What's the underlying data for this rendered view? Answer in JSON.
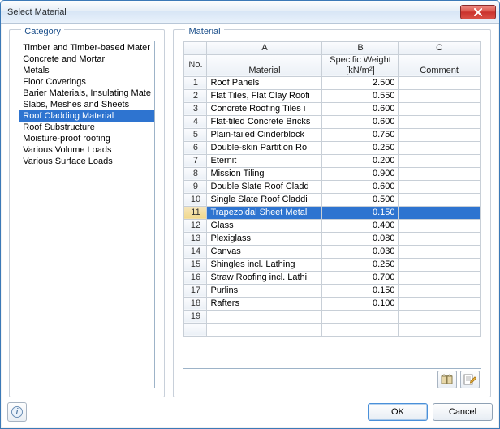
{
  "window": {
    "title": "Select Material"
  },
  "groups": {
    "category": "Category",
    "material": "Material"
  },
  "categories": {
    "items": [
      "Timber and Timber-based Mater",
      "Concrete and Mortar",
      "Metals",
      "Floor Coverings",
      "Barier Materials, Insulating Mate",
      "Slabs, Meshes and Sheets",
      "Roof Cladding Material",
      "Roof Substructure",
      "Moisture-proof roofing",
      "Various Volume Loads",
      "Various Surface Loads"
    ],
    "selected_index": 6
  },
  "grid": {
    "col_letters": [
      "A",
      "B",
      "C"
    ],
    "rowhead_label": "No.",
    "col_headers": {
      "A": "Material",
      "B_line1": "Specific Weight",
      "B_line2": "[kN/m²]",
      "C": "Comment"
    },
    "rows": [
      {
        "material": "Roof Panels",
        "weight": "2.500",
        "comment": ""
      },
      {
        "material": "Flat Tiles, Flat Clay Roofi",
        "weight": "0.550",
        "comment": ""
      },
      {
        "material": "Concrete Roofing Tiles i",
        "weight": "0.600",
        "comment": ""
      },
      {
        "material": "Flat-tiled Concrete Bricks",
        "weight": "0.600",
        "comment": ""
      },
      {
        "material": "Plain-tailed Cinderblock",
        "weight": "0.750",
        "comment": ""
      },
      {
        "material": "Double-skin Partition Ro",
        "weight": "0.250",
        "comment": ""
      },
      {
        "material": "Eternit",
        "weight": "0.200",
        "comment": ""
      },
      {
        "material": "Mission Tiling",
        "weight": "0.900",
        "comment": ""
      },
      {
        "material": "Double Slate Roof Cladd",
        "weight": "0.600",
        "comment": ""
      },
      {
        "material": "Single Slate Roof Claddi",
        "weight": "0.500",
        "comment": ""
      },
      {
        "material": "Trapezoidal Sheet Metal",
        "weight": "0.150",
        "comment": ""
      },
      {
        "material": "Glass",
        "weight": "0.400",
        "comment": ""
      },
      {
        "material": "Plexiglass",
        "weight": "0.080",
        "comment": ""
      },
      {
        "material": "Canvas",
        "weight": "0.030",
        "comment": ""
      },
      {
        "material": "Shingles incl. Lathing",
        "weight": "0.250",
        "comment": ""
      },
      {
        "material": "Straw Roofing incl. Lathi",
        "weight": "0.700",
        "comment": ""
      },
      {
        "material": "Purlins",
        "weight": "0.150",
        "comment": ""
      },
      {
        "material": "Rafters",
        "weight": "0.100",
        "comment": ""
      }
    ],
    "empty_trailing_rows": 1,
    "selected_row_index": 10
  },
  "buttons": {
    "ok": "OK",
    "cancel": "Cancel"
  },
  "icons": {
    "close": "close-icon",
    "help": "help-icon",
    "library": "library-icon",
    "edit": "edit-icon"
  }
}
